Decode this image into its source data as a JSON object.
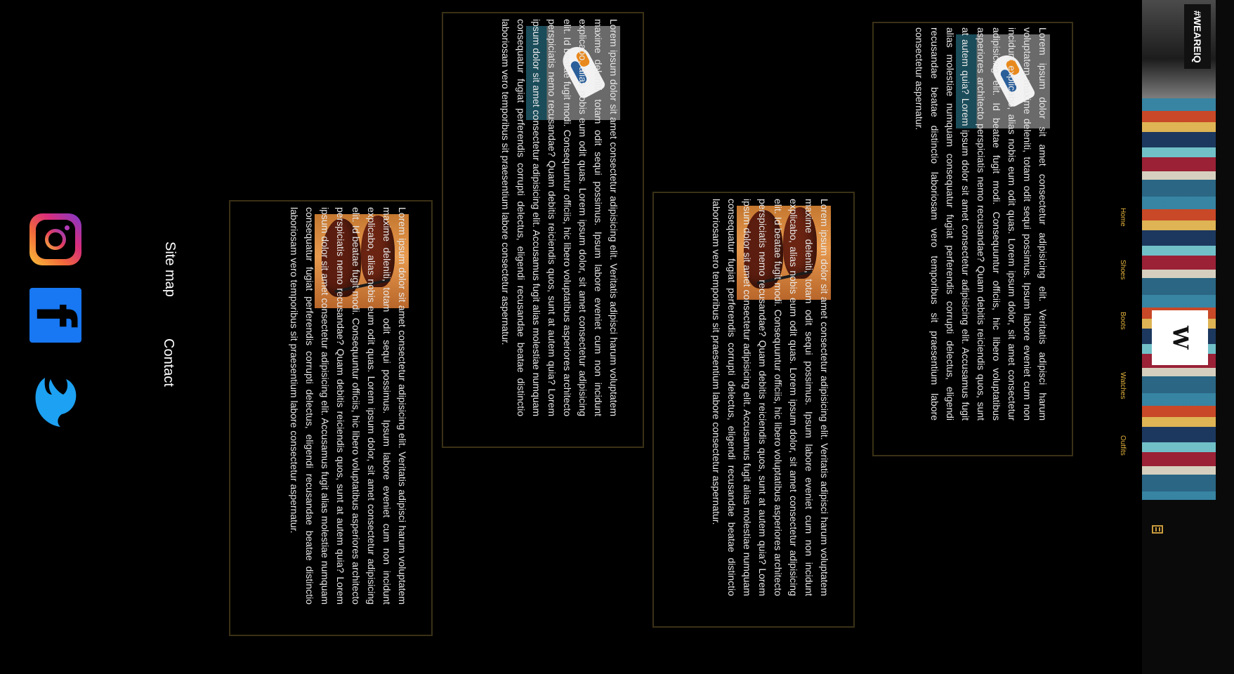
{
  "nav": {
    "items": [
      "Home",
      "Shoes",
      "Boots",
      "Watches",
      "Outfits"
    ]
  },
  "banner": {
    "tag": "#WEAREIQ",
    "logo": "W"
  },
  "cards": [
    {
      "image": "sneaker",
      "text": "Lorem ipsum dolor sit amet consectetur adipisicing elit. Veritatis adipisci harum voluptatem maxime deleniti, totam odit sequi possimus. Ipsum labore eveniet cum non incidunt explicabo, alias nobis eum odit quas. Lorem ipsum dolor, sit amet consectetur adipisicing elit. Id beatae fugit modi. Consequuntur officiis, hic libero voluptatibus asperiores architecto perspiciatis nemo recusandae? Quam debitis reiciendis quos, sunt at autem quia? Lorem ipsum dolor sit amet consectetur adipisicing elit. Accusamus fugit alias molestiae numquam consequatur fugiat perferendis corrupti delectus, eligendi recusandae beatae distinctio laboriosam vero temporibus sit praesentium labore consectetur aspernatur."
    },
    {
      "image": "boot",
      "text": "Lorem ipsum dolor sit amet consectetur adipisicing elit. Veritatis adipisci harum voluptatem maxime deleniti, totam odit sequi possimus. Ipsum labore eveniet cum non incidunt explicabo, alias nobis eum odit quas. Lorem ipsum dolor, sit amet consectetur adipisicing elit. Id beatae fugit modi. Consequuntur officiis, hic libero voluptatibus asperiores architecto perspiciatis nemo recusandae? Quam debitis reiciendis quos, sunt at autem quia? Lorem ipsum dolor sit amet consectetur adipisicing elit. Accusamus fugit alias molestiae numquam consequatur fugiat perferendis corrupti delectus, eligendi recusandae beatae distinctio laboriosam vero temporibus sit praesentium labore consectetur aspernatur."
    },
    {
      "image": "sneaker",
      "text": "Lorem ipsum dolor sit amet consectetur adipisicing elit. Veritatis adipisci harum voluptatem maxime deleniti, totam odit sequi possimus. Ipsum labore eveniet cum non incidunt explicabo, alias nobis eum odit quas. Lorem ipsum dolor, sit amet consectetur adipisicing elit. Id beatae fugit modi. Consequuntur officiis, hic libero voluptatibus asperiores architecto perspiciatis nemo recusandae? Quam debitis reiciendis quos, sunt at autem quia? Lorem ipsum dolor sit amet consectetur adipisicing elit. Accusamus fugit alias molestiae numquam consequatur fugiat perferendis corrupti delectus, eligendi recusandae beatae distinctio laboriosam vero temporibus sit praesentium labore consectetur aspernatur."
    },
    {
      "image": "boot",
      "text": "Lorem ipsum dolor sit amet consectetur adipisicing elit. Veritatis adipisci harum voluptatem maxime deleniti, totam odit sequi possimus. Ipsum labore eveniet cum non incidunt explicabo, alias nobis eum odit quas. Lorem ipsum dolor, sit amet consectetur adipisicing elit. Id beatae fugit modi. Consequuntur officiis, hic libero voluptatibus asperiores architecto perspiciatis nemo recusandae? Quam debitis reiciendis quos, sunt at autem quia? Lorem ipsum dolor sit amet consectetur adipisicing elit. Accusamus fugit alias molestiae numquam consequatur fugiat perferendis corrupti delectus, eligendi recusandae beatae distinctio laboriosam vero temporibus sit praesentium labore consectetur aspernatur."
    }
  ],
  "footer": {
    "sitemap_label": "Site map",
    "contact_label": "Contact",
    "social": {
      "instagram_icon": "instagram-icon",
      "facebook_icon": "facebook-icon",
      "twitter_icon": "twitter-icon",
      "facebook_glyph": "f"
    }
  },
  "colors": {
    "background": "#000000",
    "accent": "#e3b23c",
    "card_border": "#3a3116",
    "text": "#e9e9e9",
    "facebook": "#1877f2",
    "twitter": "#1da1f2"
  }
}
